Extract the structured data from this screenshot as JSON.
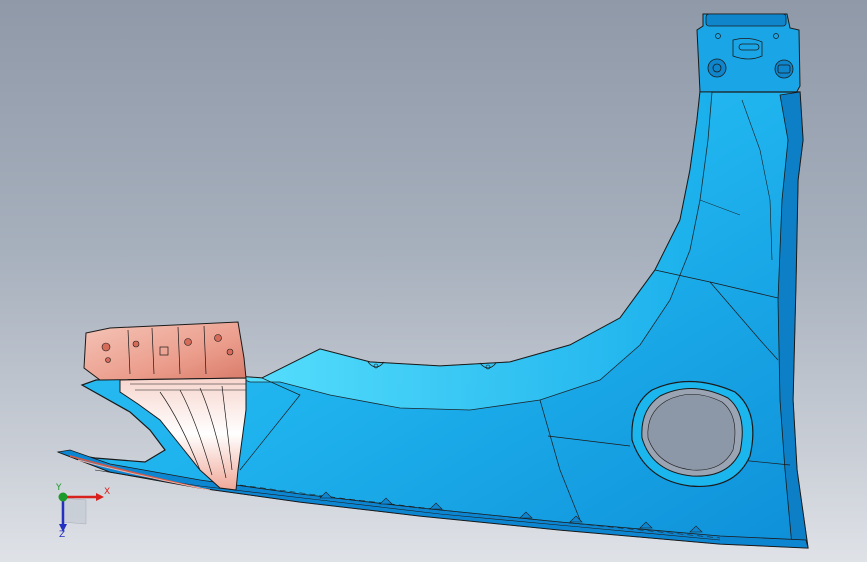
{
  "viewport": {
    "background_top": "#8f99a8",
    "background_bottom": "#dfe2e7"
  },
  "part": {
    "name": "fender-panel",
    "body_color": "#1fbaf0",
    "body_dark": "#0f8fd6",
    "bracket_color": "#f0b2a3",
    "outline_color": "#1a1a1a"
  },
  "triad": {
    "x_label": "X",
    "y_label": "Y",
    "z_label": "Z",
    "x_color": "#d8201c",
    "y_color": "#1c9a2a",
    "z_color": "#2430c0"
  }
}
